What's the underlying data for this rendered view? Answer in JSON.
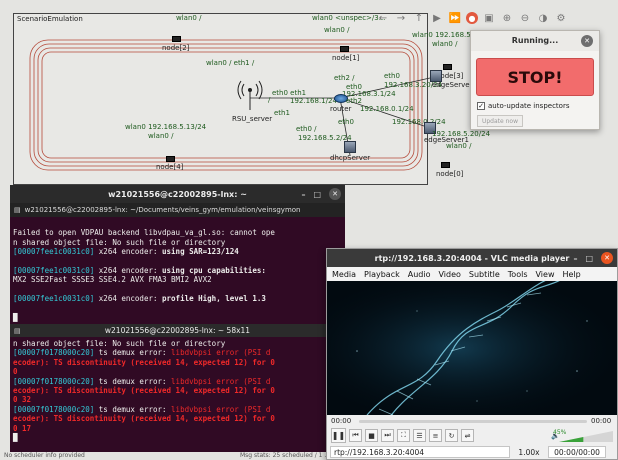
{
  "omnet": {
    "scenario_label": "ScenarioEmulation",
    "nodes": {
      "node2": "node[2]",
      "node1": "node[1]",
      "node3": "node[3]",
      "node4": "node[4]",
      "node0": "node[0]",
      "rsu": "RSU_server",
      "router": "router",
      "dhcp": "dhcpServer",
      "edge1": "edgeServer1",
      "edge0": "edgeServer"
    },
    "link_labels": {
      "top_wlan0": "wlan0 /",
      "top_right_wlan0": "wlan0 <unspec>/3...",
      "node2_wlan0": "wlan0 /",
      "wlan0_eth1": "wlan0 /     eth1 /",
      "right_wlan0_ip": "wlan0 192.168.5...",
      "right_wlan0": "wlan0 /",
      "eth2": "eth2 /",
      "eth0_a": "eth0",
      "ip_3_1": "192.168.3.1/24",
      "eth0_b": "eth0",
      "ip_3_20": "192.168.3.20/24",
      "eth0_eth1": "eth0  eth1",
      "ip_1_24": "192.168.1/24",
      "eth2_b": "eth2",
      "ip_0_1": "192.168.0.1/24",
      "rsu_slash": "/",
      "eth1_c": "eth1",
      "eth0_c": "eth0 /",
      "eth0_d": "eth0",
      "ip_0_2": "192.168.0.2/24",
      "left_wlan0_ip": "wlan0 192.168.5.13/24",
      "left_wlan0": "wlan0 /",
      "eth0_e": "eth0",
      "ip_5_2": "192.168.5.2/24",
      "edge_ip": "192.168.5.20/24",
      "edge_wlan0": "wlan0 /"
    },
    "status_left": "No scheduler info provided",
    "status_right": "Msg stats: 25 scheduled / 1 ..."
  },
  "toolbar": {
    "icons": [
      "back-icon",
      "forward-icon",
      "up-icon",
      "step-icon",
      "fast-icon",
      "record-icon",
      "snapshot-icon",
      "zoom-in-icon",
      "zoom-out-icon",
      "layout-icon",
      "settings-icon"
    ]
  },
  "run_dialog": {
    "title": "Running...",
    "stop_label": "STOP!",
    "auto_update_label": "auto-update inspectors",
    "auto_update_checked": true,
    "update_now_label": "Update now"
  },
  "terminal1": {
    "title": "w21021556@c22002895-lnx: ~",
    "tab_label": "w21021556@c22002895-lnx: ~/Documents/veins_gym/emulation/veinsgymon",
    "lines": [
      {
        "text": "",
        "cls": ""
      },
      {
        "text": "Failed to open VDPAU backend libvdpau_va_gl.so: cannot ope",
        "cls": ""
      },
      {
        "text": "n shared object file: No such file or directory",
        "cls": ""
      },
      {
        "text": "[00007fee1c0031c0] x264 encoder: using SAR=123/124",
        "cls": "mix"
      },
      {
        "text": "",
        "cls": ""
      },
      {
        "text": "[00007fee1c0031c0] x264 encoder: using cpu capabilities:",
        "cls": "mix"
      },
      {
        "text": "MX2 SSE2Fast SSSE3 SSE4.2 AVX FMA3 BMI2 AVX2",
        "cls": ""
      },
      {
        "text": "",
        "cls": ""
      },
      {
        "text": "[00007fee1c0031c0] x264 encoder: profile High, level 1.3",
        "cls": "mix"
      },
      {
        "text": "",
        "cls": ""
      },
      {
        "text": "█",
        "cls": ""
      }
    ]
  },
  "terminal2": {
    "title": "w21021556@c22002895-lnx: ~ 58x11",
    "lines": [
      {
        "text": "n shared object file: No such file or directory",
        "cls": ""
      },
      {
        "text": "[00007f0178000c20] ts demux error: libdvbpsi error (PSI d",
        "cls": "err"
      },
      {
        "text": "ecoder): TS discontinuity (received 14, expected 12) for 0",
        "cls": "red"
      },
      {
        "text": "0",
        "cls": "red"
      },
      {
        "text": "[00007f0178000c20] ts demux error: libdvbpsi error (PSI d",
        "cls": "err"
      },
      {
        "text": "ecoder): TS discontinuity (received 14, expected 12) for 0",
        "cls": "red"
      },
      {
        "text": "0 32",
        "cls": "red"
      },
      {
        "text": "[00007f0178000c20] ts demux error: libdvbpsi error (PSI d",
        "cls": "err"
      },
      {
        "text": "ecoder): TS discontinuity (received 14, expected 12) for 0",
        "cls": "red"
      },
      {
        "text": "0 17",
        "cls": "red"
      },
      {
        "text": "█",
        "cls": ""
      }
    ]
  },
  "vlc": {
    "title": "rtp://192.168.3.20:4004 - VLC media player",
    "menu": [
      "Media",
      "Playback",
      "Audio",
      "Video",
      "Subtitle",
      "Tools",
      "View",
      "Help"
    ],
    "elapsed": "00:00",
    "total": "00:00",
    "url": "rtp://192.168.3.20:4004",
    "rate": "1.00x",
    "duration": "00:00/00:00",
    "volume_label": "45%",
    "volume_level": 0.45,
    "buttons": [
      "play-pause",
      "previous",
      "stop",
      "next",
      "fullscreen",
      "extended-settings",
      "playlist",
      "loop",
      "shuffle"
    ]
  }
}
